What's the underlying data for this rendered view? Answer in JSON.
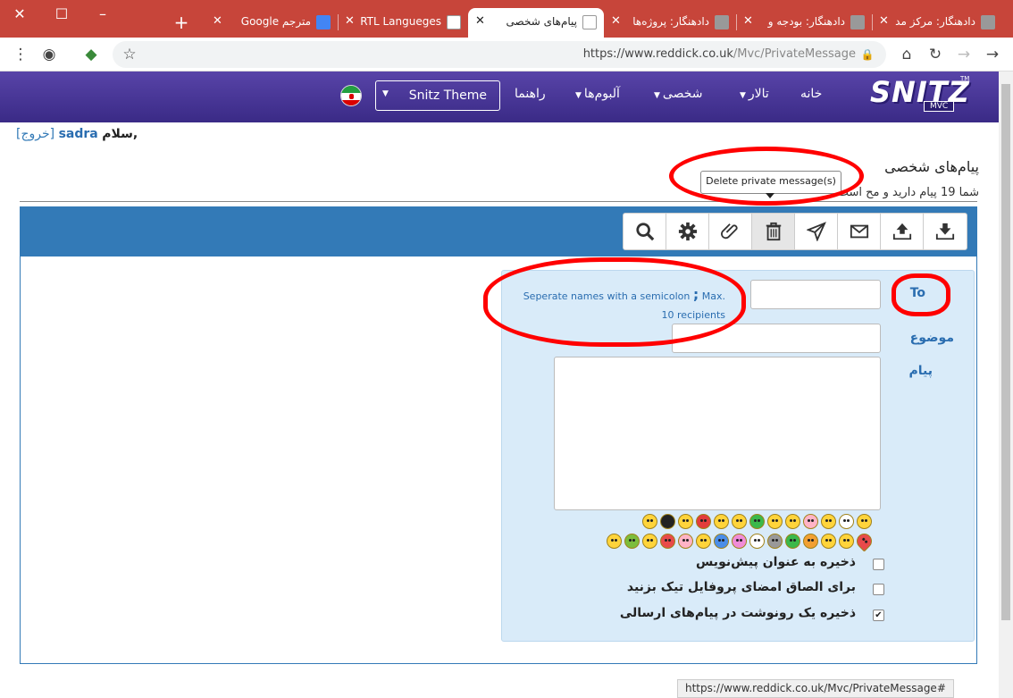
{
  "browser": {
    "tabs": [
      {
        "title": "دادهنگار: مرکز مد",
        "icon": "site-icon"
      },
      {
        "title": "دادهنگار: بودجه و",
        "icon": "site-icon"
      },
      {
        "title": "دادهنگار: پروژه‌ها",
        "icon": "site-icon"
      },
      {
        "title": "پیام‌های شخصی",
        "icon": "snitz-icon",
        "active": true
      },
      {
        "title": "RTL Langueges",
        "icon": "snitz-icon"
      },
      {
        "title": "مترجم Google",
        "icon": "google-translate-icon"
      }
    ],
    "url_domain": "https://www.reddick.co.uk",
    "url_path": "/Mvc/PrivateMessage",
    "status_url": "https://www.reddick.co.uk/Mvc/PrivateMessage#"
  },
  "navbar": {
    "logo_text": "SNITZ",
    "logo_sub": "MVC",
    "logo_tm": "TM",
    "links": {
      "home": "خانه",
      "forum": "تالار",
      "personal": "شخصی",
      "albums": "آلبوم‌ها",
      "help": "راهنما"
    },
    "theme": "Snitz Theme"
  },
  "welcome": {
    "logout": "[خروج]",
    "user": "sadra",
    "greeting": "سلام,"
  },
  "page": {
    "title": "پیام‌های شخصی",
    "message_count": "شما 19 پیام دارید و مح  ‌است.",
    "tooltip": "Delete private message(s)"
  },
  "form": {
    "to_label": "To",
    "subject_label": "موضوع",
    "message_label": "پیام",
    "hint_line1": "Seperate names with a semicolon",
    "hint_semicolon": ";",
    "hint_line1b": "Max.",
    "hint_line2": "10 recipients",
    "options": [
      {
        "label": "ذخیره به عنوان پیش‌نویس",
        "checked": false
      },
      {
        "label": "برای الصاق امضای پروفایل تیک بزنید",
        "checked": false
      },
      {
        "label": "ذخیره یک رونوشت در پیام‌های ارسالی",
        "checked": true
      }
    ],
    "checkmark": "✔"
  },
  "colors": {
    "tab_strip": "#c7453a",
    "navbar": "#4a37a0",
    "panel_header": "#337ab7",
    "form_bg": "#d9ebf9",
    "annotation": "#ff0000"
  }
}
